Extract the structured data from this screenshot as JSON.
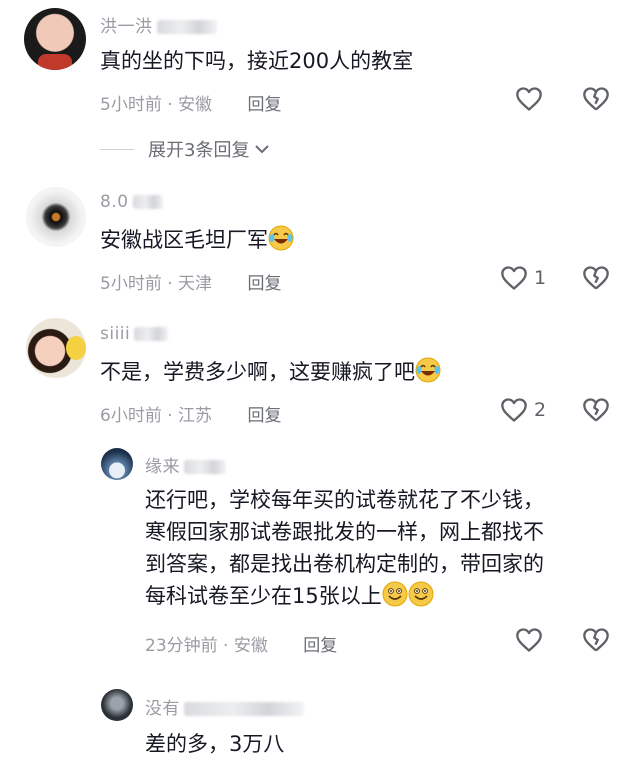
{
  "comments": [
    {
      "username": "洪一洪",
      "text": "真的坐的下吗，接近200人的教室",
      "time": "5小时前",
      "location": "安徽",
      "reply_label": "回复",
      "likes": "",
      "expand": "展开3条回复"
    },
    {
      "username": "8.0",
      "text": "安徽战区毛坦厂军",
      "time": "5小时前",
      "location": "天津",
      "reply_label": "回复",
      "likes": "1"
    },
    {
      "username": "siiii",
      "text": "不是，学费多少啊，这要赚疯了吧",
      "time": "6小时前",
      "location": "江苏",
      "reply_label": "回复",
      "likes": "2"
    }
  ],
  "replies": [
    {
      "username": "缘来",
      "text_lines": [
        "还行吧，学校每年买的试卷就花了不少钱，",
        "寒假回家那试卷跟批发的一样，网上都找不",
        "到答案，都是找出卷机构定制的，带回家的",
        "每科试卷至少在15张以上"
      ],
      "time": "23分钟前",
      "location": "安徽",
      "reply_label": "回复",
      "likes": ""
    },
    {
      "username": "没有",
      "text": "差的多，3万八"
    }
  ],
  "separator": "·",
  "icons": {
    "like": "heart-icon",
    "dislike": "broken-heart-icon",
    "expand": "chevron-down-icon",
    "emoji_laugh": "laughing-tears-emoji",
    "emoji_smile": "smiling-emoji"
  },
  "colors": {
    "text": "#161823",
    "meta": "#9a9ca3",
    "reply": "#6b6d75"
  }
}
